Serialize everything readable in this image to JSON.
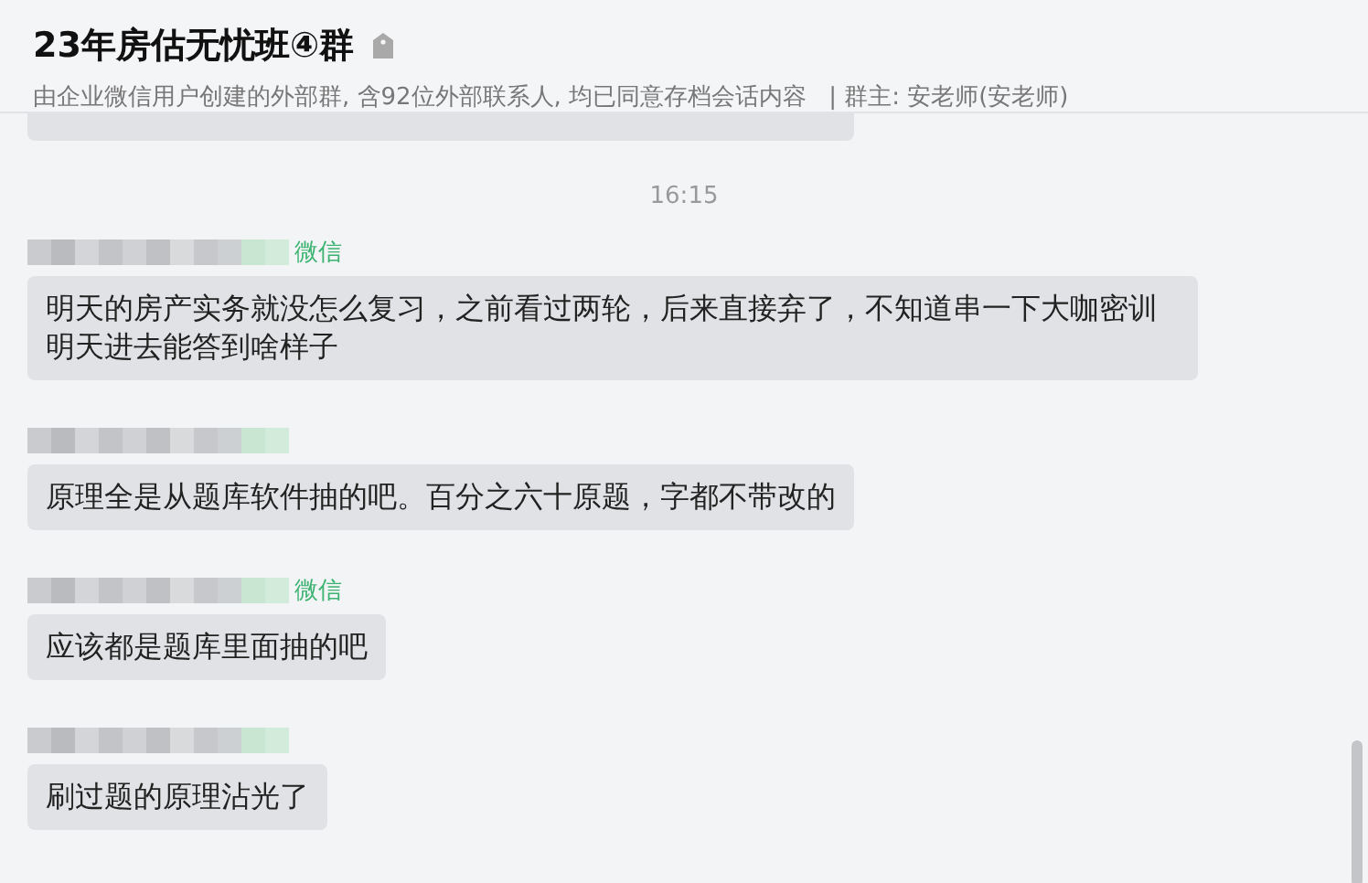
{
  "header": {
    "title": "23年房估无忧班④群",
    "subtitle": "由企业微信用户创建的外部群, 含92位外部联系人, 均已同意存档会话内容",
    "owner": "| 群主: 安老师(安老师)"
  },
  "time": "16:15",
  "messages": [
    {
      "sender_tag": "微信",
      "text": "明天的房产实务就没怎么复习，之前看过两轮，后来直接弃了，不知道串一下大咖密训明天进去能答到啥样子"
    },
    {
      "text": "原理全是从题库软件抽的吧。百分之六十原题，字都不带改的"
    },
    {
      "sender_tag": "微信",
      "text": "应该都是题库里面抽的吧"
    },
    {
      "text": "刷过题的原理沾光了"
    }
  ]
}
